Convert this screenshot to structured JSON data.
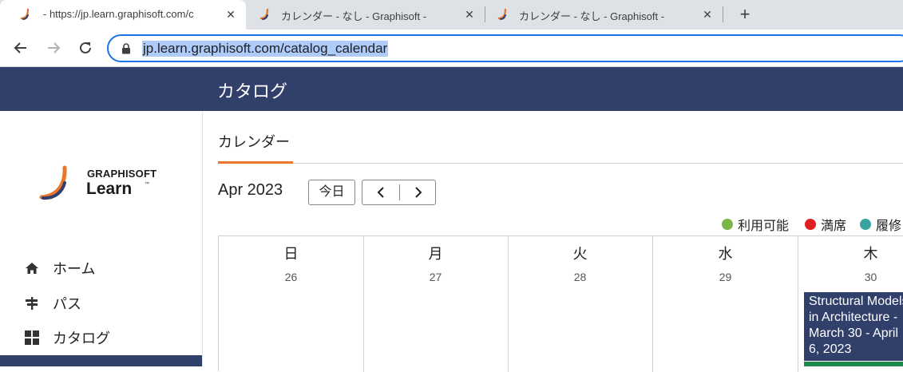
{
  "browser": {
    "tabs": [
      {
        "title": "- https://jp.learn.graphisoft.com/c",
        "active": true
      },
      {
        "title": "カレンダー - なし - Graphisoft -",
        "active": false
      },
      {
        "title": "カレンダー - なし - Graphisoft -",
        "active": false
      }
    ],
    "close_glyph": "✕",
    "newtab_glyph": "+",
    "url": "jp.learn.graphisoft.com/catalog_calendar"
  },
  "header": {
    "title": "カタログ"
  },
  "logo": {
    "top": "GRAPHISOFT",
    "bottom": "Learn",
    "tm": "™"
  },
  "sidebar": {
    "items": [
      {
        "label": "ホーム",
        "icon": "home-icon"
      },
      {
        "label": "パス",
        "icon": "signpost-icon"
      },
      {
        "label": "カタログ",
        "icon": "grid-icon"
      }
    ]
  },
  "main": {
    "tab_label": "カレンダー",
    "month": "Apr 2023",
    "today_label": "今日",
    "legend": [
      {
        "label": "利用可能",
        "color": "#7ab648"
      },
      {
        "label": "満席",
        "color": "#e02020"
      },
      {
        "label": "履修",
        "color": "#3aa3a0"
      }
    ],
    "days": [
      {
        "name": "日",
        "date": "26"
      },
      {
        "name": "月",
        "date": "27"
      },
      {
        "name": "火",
        "date": "28"
      },
      {
        "name": "水",
        "date": "29"
      },
      {
        "name": "木",
        "date": "30"
      }
    ],
    "event": {
      "title": "Structural Models in Architecture - March 30 - April 6, 2023"
    }
  },
  "colors": {
    "accent": "#e8772e",
    "brand": "#313f6b",
    "focus": "#1a73e8"
  }
}
